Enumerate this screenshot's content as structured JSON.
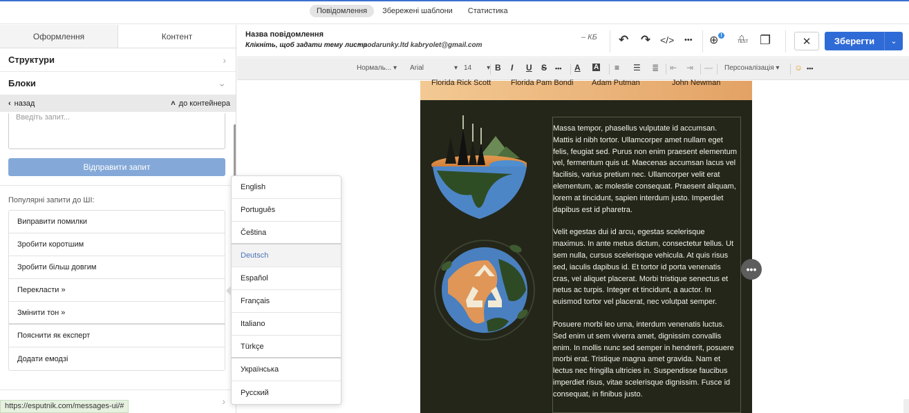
{
  "topnav": {
    "tabs": [
      {
        "label": "Повідомлення"
      },
      {
        "label": "Збережені шаблони"
      },
      {
        "label": "Статистика"
      }
    ]
  },
  "left": {
    "tabs": [
      "Оформлення",
      "Контент"
    ],
    "sections": [
      "Структури",
      "Блоки"
    ],
    "back": "назад",
    "to_container": "до контейнера",
    "query_placeholder": "Введіть запит...",
    "send": "Відправити запит",
    "popular_label": "Популярні запити до ШІ:",
    "popular": [
      "Виправити помилки",
      "Зробити коротшим",
      "Зробити більш довгим",
      "Перекласти »",
      "Змінити тон »",
      "Пояснити як експерт",
      "Додати емодзі"
    ]
  },
  "languages": [
    "English",
    "Português",
    "Čeština",
    "Deutsch",
    "Español",
    "Français",
    "Italiano",
    "Türkçe",
    "Українська",
    "Русский"
  ],
  "status_url": "https://esputnik.com/messages-ui/#",
  "header": {
    "message_name": "Назва повідомлення",
    "subject": "Клікніть, щоб задати тему листа",
    "sender": "podarunky.ltd kabryolet@gmail.com",
    "size": "– КБ",
    "save": "Зберегти",
    "badge": "!",
    "icons": {
      "undo": "↶",
      "redo": "↷",
      "code": "</>",
      "more": "•••",
      "globe": "⊕",
      "test": "TEST",
      "copy": "❐",
      "close": "✕",
      "chev": "⌄"
    }
  },
  "toolbar": {
    "style": "Нормаль...",
    "font": "Arial",
    "size": "14",
    "personalization": "Персоналізація",
    "bold": "B",
    "italic": "I",
    "underline": "U",
    "strike": "S",
    "more": "•••",
    "color": "A",
    "bgcolor": "A",
    "align": "≡",
    "list": "☰",
    "indent": "⇥",
    "outdent": "⇤",
    "hr": "—",
    "emoji": "☺"
  },
  "email": {
    "names": [
      "Florida Rick Scott",
      "Florida Pam Bondi",
      "Adam Putman",
      "John Newman"
    ],
    "paragraphs": [
      "Massa tempor, phasellus vulputate id accumsan. Mattis id nibh tortor. Ullamcorper amet nullam eget felis, feugiat sed. Purus non enim praesent elementum vel, fermentum quis ut. Maecenas accumsan lacus vel facilisis, varius pretium nec. Ullamcorper velit erat elementum, ac molestie consequat. Praesent aliquam, lorem at tincidunt, sapien interdum justo. Imperdiet dapibus est id pharetra.",
      "Velit egestas dui id arcu, egestas scelerisque maximus. In ante metus dictum, consectetur tellus. Ut sem nulla, cursus scelerisque vehicula. At quis risus sed, iaculis dapibus id. Et tortor id porta venenatis cras, vel aliquet placerat. Morbi tristique senectus et netus ac turpis. Integer et tincidunt, a auctor. In euismod tortor vel placerat, nec volutpat semper.",
      "Posuere morbi leo urna, interdum venenatis luctus. Sed enim ut sem viverra amet, dignissim convallis enim. In mollis nunc sed semper in hendrerit, posuere morbi erat. Tristique magna amet gravida. Nam et lectus nec fringilla ultricies in. Suspendisse faucibus imperdiet risus, vitae scelerisque dignissim. Fusce id consequat, in finibus justo."
    ],
    "handle": "•••"
  },
  "colors": {
    "accent": "#2f6bd6",
    "email_bg": "#232619",
    "orange_start": "#f3c993",
    "orange_end": "#e3a265"
  }
}
